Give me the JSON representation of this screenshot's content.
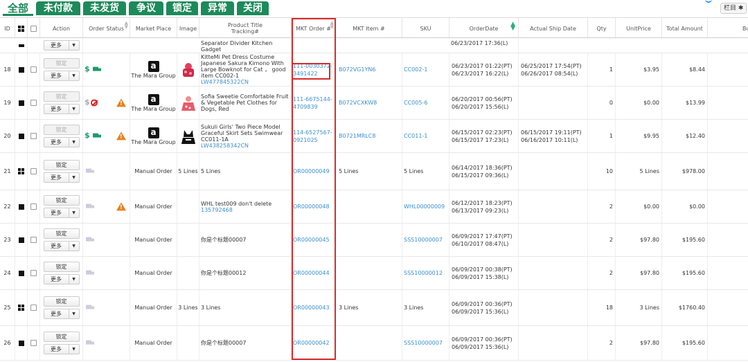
{
  "tabs": [
    "全部",
    "未付款",
    "未发货",
    "争议",
    "锁定",
    "异常",
    "关闭"
  ],
  "column_settings_label": "栏目",
  "headers": {
    "id": "ID",
    "action": "Action",
    "order_status": "Order Status",
    "market_place": "Market Place",
    "image": "Image",
    "product_title_line1": "Product Title",
    "product_title_line2": "Tracking#",
    "mkt_order": "MKT Order #",
    "mkt_item": "MKT Item #",
    "sku": "SKU",
    "order_date": "OrderDate",
    "actual_ship_date": "Actual Ship Date",
    "qty": "Qty",
    "unit_price": "UnitPrice",
    "total_amount": "Total Amount",
    "buyer": "Buye"
  },
  "partial_row": {
    "title": "Separator Divider Kitchen Gadget",
    "date1": "06/23/2017 17:36(L)"
  },
  "buttons": {
    "lock": "锁定",
    "more": "更多"
  },
  "rows": [
    {
      "id": "18",
      "icon": "square",
      "lock_disabled": true,
      "status": "paid-shipped",
      "warn": false,
      "market": "The Mara Group",
      "amazon": true,
      "image": "kimono",
      "title": "KitteMi Pet Dress Costume Japanese Sakura Kimono With Large Bowknot for Cat ， good item CC002-1",
      "tracking": "LW477845322CN",
      "mkt_order": "111-0030372-3491422",
      "mkt_item": "B072VG1YN6",
      "sku": "CC002-1",
      "order_date1": "06/23/2017 01:22(PT)",
      "order_date2": "06/23/2017 16:22(L)",
      "ship_date1": "06/25/2017 17:54(PT)",
      "ship_date2": "06/26/2017 08:54(L)",
      "qty": "1",
      "unit_price": "$3.95",
      "total": "$8.44"
    },
    {
      "id": "19",
      "icon": "square",
      "lock_disabled": true,
      "status": "unpaid-cancel",
      "warn": true,
      "market": "The Mara Group",
      "amazon": true,
      "image": "dress",
      "title": "Sofia Sweetie Comfortable Fruit & Vegetable Pet Clothes for Dogs, Red",
      "tracking": "",
      "mkt_order": "111-6675144-4709839",
      "mkt_item": "B072VCXKW8",
      "sku": "CC005-6",
      "order_date1": "06/20/2017 00:56(PT)",
      "order_date2": "06/20/2017 15:56(L)",
      "ship_date1": "",
      "ship_date2": "",
      "qty": "0",
      "unit_price": "$0.00",
      "total": "$13.99"
    },
    {
      "id": "20",
      "icon": "square",
      "lock_disabled": true,
      "status": "paid-shipped",
      "warn": true,
      "market": "The Mara Group",
      "amazon": true,
      "image": "swimwear",
      "title": "Sukuli Girls' Two Piece Model Graceful Skirt Sets Swimwear CC011-1A",
      "tracking": "LW438258342CN",
      "mkt_order": "114-6527567-0921025",
      "mkt_item": "B0721MRLC8",
      "sku": "CC011-1",
      "order_date1": "06/15/2017 02:23(PT)",
      "order_date2": "06/15/2017 17:23(L)",
      "ship_date1": "06/15/2017 19:11(PT)",
      "ship_date2": "06/16/2017 10:11(L)",
      "qty": "1",
      "unit_price": "$9.95",
      "total": "$12.40"
    },
    {
      "id": "21",
      "icon": "grid",
      "lock_disabled": false,
      "status": "truck-only",
      "warn": false,
      "market": "Manual Order",
      "amazon": false,
      "image": "",
      "image_text": "5 Lines",
      "title": "5 Lines",
      "tracking": "",
      "mkt_order": "OR00000049",
      "mkt_item": "5 Lines",
      "sku": "5 Lines",
      "order_date1": "06/14/2017 18:36(PT)",
      "order_date2": "06/15/2017 09:36(L)",
      "ship_date1": "",
      "ship_date2": "",
      "qty": "10",
      "unit_price": "5 Lines",
      "total": "$978.00"
    },
    {
      "id": "22",
      "icon": "square",
      "lock_disabled": false,
      "status": "truck-only",
      "warn": true,
      "market": "Manual Order",
      "amazon": false,
      "image": "",
      "title": "WHL test009 don't delete",
      "tracking": "135792468",
      "mkt_order": "OR00000048",
      "mkt_item": "",
      "sku": "WHL00000009",
      "order_date1": "06/12/2017 18:23(PT)",
      "order_date2": "06/13/2017 09:23(L)",
      "ship_date1": "",
      "ship_date2": "",
      "qty": "2",
      "unit_price": "$0.00",
      "total": "$0.00"
    },
    {
      "id": "23",
      "icon": "square",
      "lock_disabled": false,
      "status": "truck-only",
      "warn": false,
      "market": "Manual Order",
      "amazon": false,
      "image": "",
      "title": "你是个标题00007",
      "tracking": "",
      "mkt_order": "OR00000045",
      "mkt_item": "",
      "sku": "SSS10000007",
      "order_date1": "06/09/2017 17:47(PT)",
      "order_date2": "06/10/2017 08:47(L)",
      "ship_date1": "",
      "ship_date2": "",
      "qty": "2",
      "unit_price": "$97.80",
      "total": "$195.60"
    },
    {
      "id": "24",
      "icon": "square",
      "lock_disabled": false,
      "status": "truck-only",
      "warn": false,
      "market": "Manual Order",
      "amazon": false,
      "image": "",
      "title": "你是个标题00012",
      "tracking": "",
      "mkt_order": "OR00000044",
      "mkt_item": "",
      "sku": "SSS10000012",
      "order_date1": "06/09/2017 00:38(PT)",
      "order_date2": "06/09/2017 15:38(L)",
      "ship_date1": "",
      "ship_date2": "",
      "qty": "2",
      "unit_price": "$97.80",
      "total": "$195.60"
    },
    {
      "id": "25",
      "icon": "grid",
      "lock_disabled": false,
      "status": "truck-only",
      "warn": false,
      "market": "Manual Order",
      "amazon": false,
      "image": "",
      "image_text": "3 Lines",
      "title": "3 Lines",
      "tracking": "",
      "mkt_order": "OR00000043",
      "mkt_item": "3 Lines",
      "sku": "3 Lines",
      "order_date1": "06/09/2017 00:36(PT)",
      "order_date2": "06/09/2017 15:36(L)",
      "ship_date1": "",
      "ship_date2": "",
      "qty": "18",
      "unit_price": "3 Lines",
      "total": "$1760.40"
    },
    {
      "id": "26",
      "icon": "square",
      "lock_disabled": false,
      "status": "truck-only",
      "warn": false,
      "market": "Manual Order",
      "amazon": false,
      "image": "",
      "title": "你是个标题00007",
      "tracking": "",
      "mkt_order": "OR00000042",
      "mkt_item": "",
      "sku": "SSS10000007",
      "order_date1": "06/09/2017 00:36(PT)",
      "order_date2": "06/09/2017 15:36(L)",
      "ship_date1": "",
      "ship_date2": "",
      "qty": "2",
      "unit_price": "$97.80",
      "total": "$195.60"
    }
  ]
}
